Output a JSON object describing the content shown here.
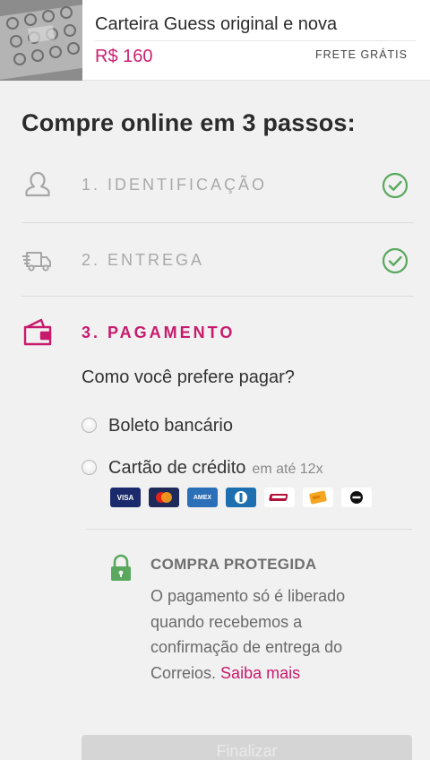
{
  "product": {
    "title": "Carteira Guess original e nova",
    "price": "R$ 160",
    "shipping": "FRETE GRÁTIS",
    "image_icon": "wallet-photo"
  },
  "checkout": {
    "heading": "Compre online em 3 passos:",
    "steps": [
      {
        "label": "1. IDENTIFICAÇÃO",
        "icon": "user-icon",
        "status": "done"
      },
      {
        "label": "2. ENTREGA",
        "icon": "truck-icon",
        "status": "done"
      },
      {
        "label": "3. PAGAMENTO",
        "icon": "wallet-icon",
        "status": "active"
      }
    ]
  },
  "payment": {
    "question": "Como você prefere pagar?",
    "options": [
      {
        "label": "Boleto bancário",
        "sub": ""
      },
      {
        "label": "Cartão de crédito",
        "sub": "em até 12x"
      }
    ],
    "cards": [
      {
        "name": "VISA",
        "color": "#1a2a6c"
      },
      {
        "name": "mastercard",
        "color": "#1e2a5a"
      },
      {
        "name": "AMEX",
        "color": "#2a6fb7"
      },
      {
        "name": "diners",
        "color": "#1d6fb0"
      },
      {
        "name": "hipercard",
        "color": "#ffffff"
      },
      {
        "name": "elo",
        "color": "#ffffff"
      },
      {
        "name": "other",
        "color": "#ffffff"
      }
    ]
  },
  "protection": {
    "title": "COMPRA PROTEGIDA",
    "text": "O pagamento só é liberado quando recebemos a confirmação de entrega do Correios.",
    "link": "Saiba mais"
  },
  "colors": {
    "accent": "#c81a6c",
    "success": "#5aa85e"
  }
}
